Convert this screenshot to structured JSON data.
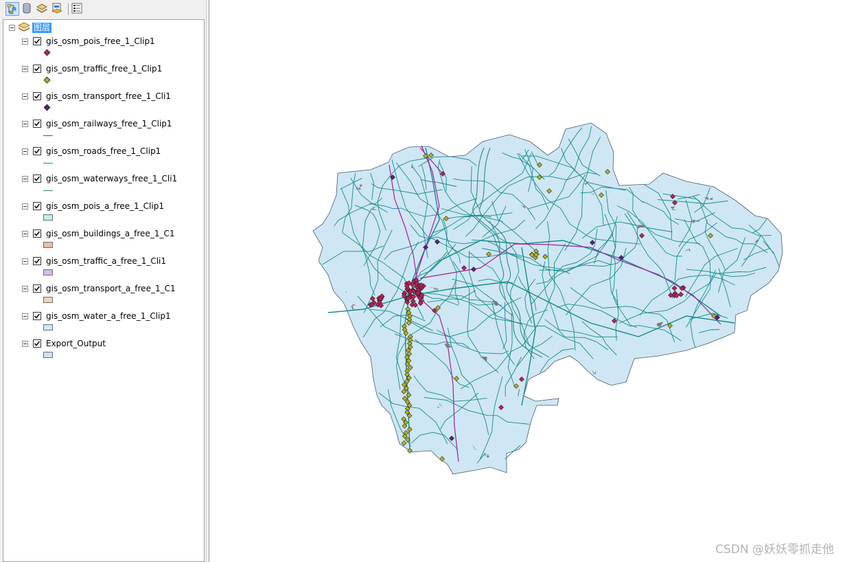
{
  "toc": {
    "root_label": "图层",
    "layers": [
      {
        "name": "gis_osm_pois_free_1_Clip1",
        "symbol": "marker",
        "color": "#c21e5a"
      },
      {
        "name": "gis_osm_traffic_free_1_Clip1",
        "symbol": "marker",
        "color": "#b5b51c"
      },
      {
        "name": "gis_osm_transport_free_1_Cli1",
        "symbol": "marker",
        "color": "#5a1e8c"
      },
      {
        "name": "gis_osm_railways_free_1_Clip1",
        "symbol": "line",
        "color": "#a31ea3"
      },
      {
        "name": "gis_osm_roads_free_1_Clip1",
        "symbol": "line",
        "color": "#1a8c8c"
      },
      {
        "name": "gis_osm_waterways_free_1_Cli1",
        "symbol": "line",
        "color": "#2a8080"
      },
      {
        "name": "gis_osm_pois_a_free_1_Clip1",
        "symbol": "fill",
        "color": "#bdf2f2"
      },
      {
        "name": "gis_osm_buildings_a_free_1_C1",
        "symbol": "fill",
        "color": "#e8c0a8"
      },
      {
        "name": "gis_osm_traffic_a_free_1_Cli1",
        "symbol": "fill",
        "color": "#dcb8ee"
      },
      {
        "name": "gis_osm_transport_a_free_1_C1",
        "symbol": "fill",
        "color": "#f5d2b8"
      },
      {
        "name": "gis_osm_water_a_free_1_Clip1",
        "symbol": "fill",
        "color": "#c4ecf5"
      },
      {
        "name": "Export_Output",
        "symbol": "fill",
        "color": "#cfe4f3"
      }
    ]
  },
  "map": {
    "region_fill": "#cfe6f4",
    "road_color": "#128c8c",
    "railway_color": "#a020a0",
    "building_color": "#7a7a7a",
    "poi_colors": [
      "#c21e5a",
      "#b5b51c",
      "#5a1e8c"
    ]
  },
  "watermark": "CSDN @妖妖零抓走他"
}
